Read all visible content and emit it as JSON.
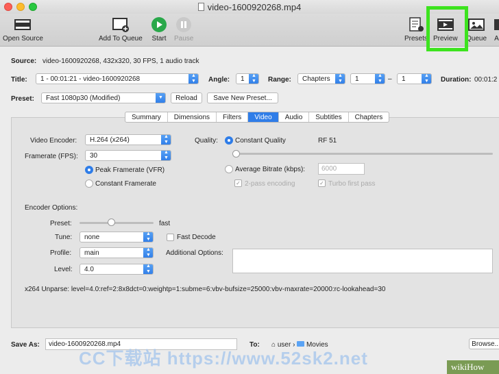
{
  "window": {
    "title": "video-1600920268.mp4"
  },
  "toolbar": {
    "open_source": "Open Source",
    "add_to_queue": "Add To Queue",
    "start": "Start",
    "pause": "Pause",
    "presets": "Presets",
    "preview": "Preview",
    "queue": "Queue",
    "activity": "Ac"
  },
  "source": {
    "label": "Source:",
    "value": "video-1600920268, 432x320, 30 FPS, 1 audio track"
  },
  "title_row": {
    "label": "Title:",
    "value": "1 - 00:01:21 - video-1600920268",
    "angle_label": "Angle:",
    "angle": "1",
    "range_label": "Range:",
    "range_type": "Chapters",
    "range_from": "1",
    "range_dash": "–",
    "range_to": "1",
    "duration_label": "Duration:",
    "duration": "00:01:2"
  },
  "preset_row": {
    "label": "Preset:",
    "value": "Fast 1080p30 (Modified)",
    "reload": "Reload",
    "save_new": "Save New Preset..."
  },
  "tabs": [
    "Summary",
    "Dimensions",
    "Filters",
    "Video",
    "Audio",
    "Subtitles",
    "Chapters"
  ],
  "video": {
    "encoder_label": "Video Encoder:",
    "encoder": "H.264 (x264)",
    "framerate_label": "Framerate (FPS):",
    "framerate": "30",
    "peak": "Peak Framerate (VFR)",
    "constant": "Constant Framerate",
    "quality_label": "Quality:",
    "cq": "Constant Quality",
    "rf": "RF 51",
    "avg_label": "Average Bitrate (kbps):",
    "avg_value": "6000",
    "two_pass": "2-pass encoding",
    "turbo": "Turbo first pass"
  },
  "encoder_options": {
    "title": "Encoder Options:",
    "preset_label": "Preset:",
    "preset_value": "fast",
    "tune_label": "Tune:",
    "tune": "none",
    "fast_decode": "Fast Decode",
    "profile_label": "Profile:",
    "profile": "main",
    "additional_label": "Additional Options:",
    "level_label": "Level:",
    "level": "4.0",
    "unparse": "x264 Unparse: level=4.0:ref=2:8x8dct=0:weightp=1:subme=6:vbv-bufsize=25000:vbv-maxrate=20000:rc-lookahead=30"
  },
  "save": {
    "label": "Save As:",
    "value": "video-1600920268.mp4",
    "to_label": "To:",
    "user": "user",
    "movies": "Movies",
    "browse": "Browse..."
  },
  "watermark": "CC下载站 https://www.52sk2.net",
  "wikihow": "wikiHow",
  "colors": {
    "accent": "#2f7de8",
    "highlight": "#3de31f",
    "start": "#29a84a"
  }
}
